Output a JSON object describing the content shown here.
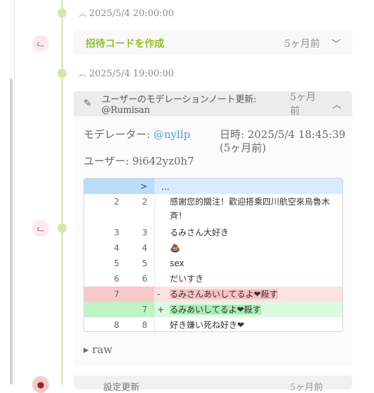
{
  "timeline": {
    "date1": "2025/5/4 20:00:00",
    "date2": "2025/5/4 19:00:00"
  },
  "invite_card": {
    "title": "招待コードを作成",
    "time_ago": "5ヶ月前",
    "chevron": "chevron-down-icon"
  },
  "note_card": {
    "title": "ユーザーのモデレーションノート更新: @Rumisan",
    "time_ago": "5ヶ月前",
    "chevron": "chevron-up-icon",
    "moderator_label": "モデレーター:",
    "moderator_name": "@nyllp",
    "datetime_label": "日時: 2025/5/4 18:45:39",
    "datetime_relative": "(5ヶ月前)",
    "user_label": "ユーザー: 9i642yz0h7",
    "raw_label": "▸ raw"
  },
  "diff": {
    "header_marker": ">",
    "header_text": "...",
    "rows": [
      {
        "old": "2",
        "new": "2",
        "mark": "",
        "text": "感謝您的關注！歡迎搭乘四川航空來烏魯木斉！",
        "type": "same"
      },
      {
        "old": "3",
        "new": "3",
        "mark": "",
        "text": "るみさん大好き",
        "type": "same"
      },
      {
        "old": "4",
        "new": "4",
        "mark": "",
        "text": "💩",
        "type": "same"
      },
      {
        "old": "5",
        "new": "5",
        "mark": "",
        "text": "sex",
        "type": "same"
      },
      {
        "old": "6",
        "new": "6",
        "mark": "",
        "text": "だいすき",
        "type": "same"
      },
      {
        "old": "7",
        "new": "",
        "mark": "-",
        "text": "るみさんあいしてるよ❤殺す",
        "type": "del"
      },
      {
        "old": "",
        "new": "7",
        "mark": "+",
        "text": "るみあいしてるよ❤殺す",
        "type": "add"
      },
      {
        "old": "8",
        "new": "8",
        "mark": "",
        "text": "好き嫌い死ね好き❤",
        "type": "same"
      }
    ]
  },
  "bottom_card": {
    "title": "設定更新",
    "time_ago": "5ヶ月前"
  },
  "colors": {
    "accent_green": "#96bf2a",
    "timeline": "#dfeec0",
    "link": "#4fa0c4"
  }
}
